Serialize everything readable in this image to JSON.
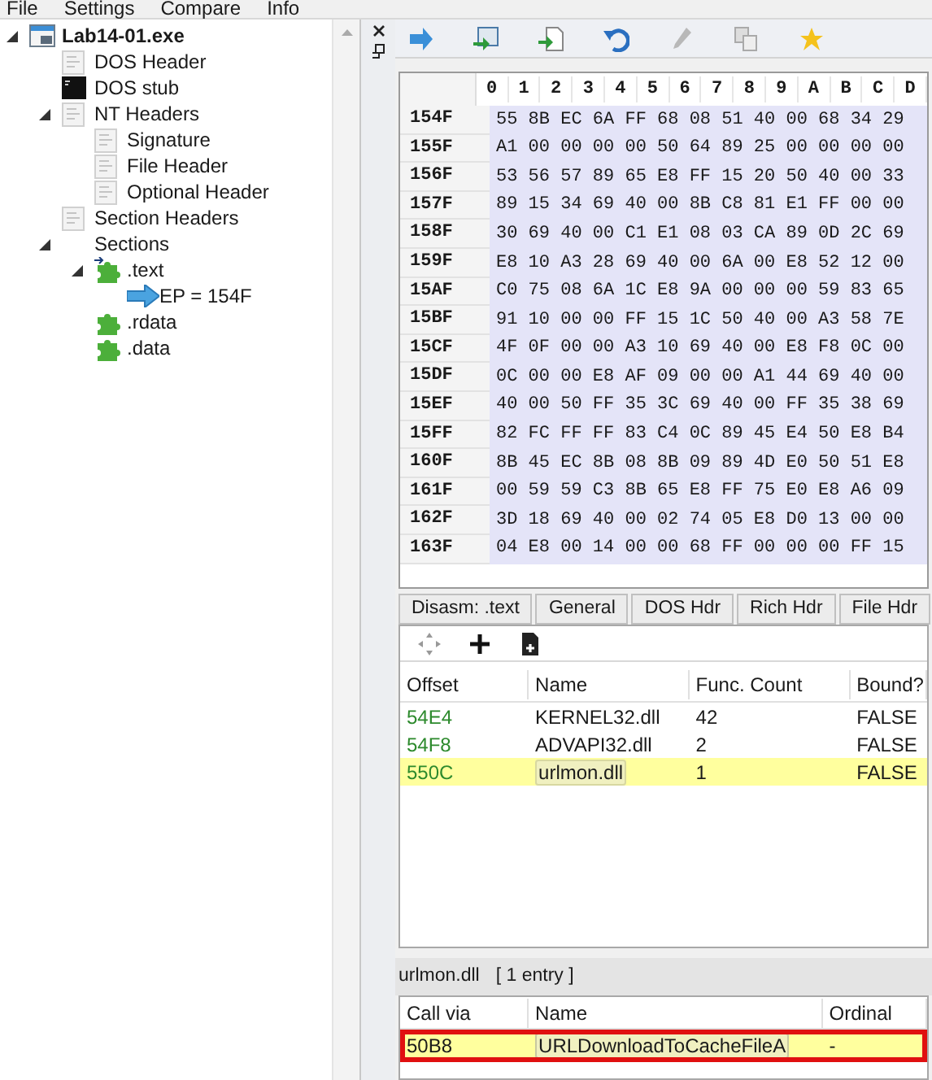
{
  "menu": [
    "File",
    "Settings",
    "Compare",
    "Info"
  ],
  "tree": [
    {
      "label": "Lab14-01.exe",
      "kind": "exe",
      "expanded": true,
      "children": [
        {
          "label": "DOS Header",
          "kind": "header"
        },
        {
          "label": "DOS stub",
          "kind": "console"
        },
        {
          "label": "NT Headers",
          "kind": "header",
          "expanded": true,
          "children": [
            {
              "label": "Signature",
              "kind": "header"
            },
            {
              "label": "File Header",
              "kind": "header"
            },
            {
              "label": "Optional Header",
              "kind": "header"
            }
          ]
        },
        {
          "label": "Section Headers",
          "kind": "header"
        },
        {
          "label": "Sections",
          "kind": "folder",
          "expanded": true,
          "children": [
            {
              "label": ".text",
              "kind": "entry-section",
              "expanded": true,
              "children": [
                {
                  "label": "EP = 154F",
                  "kind": "entry"
                }
              ]
            },
            {
              "label": ".rdata",
              "kind": "section"
            },
            {
              "label": ".data",
              "kind": "section"
            }
          ]
        }
      ]
    }
  ],
  "hex": {
    "columns": [
      "0",
      "1",
      "2",
      "3",
      "4",
      "5",
      "6",
      "7",
      "8",
      "9",
      "A",
      "B",
      "C",
      "D"
    ],
    "rows": [
      {
        "offset": "154F",
        "bytes": "55 8B EC 6A FF 68 08 51 40 00 68 34 29"
      },
      {
        "offset": "155F",
        "bytes": "A1 00 00 00 00 50 64 89 25 00 00 00 00"
      },
      {
        "offset": "156F",
        "bytes": "53 56 57 89 65 E8 FF 15 20 50 40 00 33"
      },
      {
        "offset": "157F",
        "bytes": "89 15 34 69 40 00 8B C8 81 E1 FF 00 00"
      },
      {
        "offset": "158F",
        "bytes": "30 69 40 00 C1 E1 08 03 CA 89 0D 2C 69"
      },
      {
        "offset": "159F",
        "bytes": "E8 10 A3 28 69 40 00 6A 00 E8 52 12 00"
      },
      {
        "offset": "15AF",
        "bytes": "C0 75 08 6A 1C E8 9A 00 00 00 59 83 65"
      },
      {
        "offset": "15BF",
        "bytes": "91 10 00 00 FF 15 1C 50 40 00 A3 58 7E"
      },
      {
        "offset": "15CF",
        "bytes": "4F 0F 00 00 A3 10 69 40 00 E8 F8 0C 00"
      },
      {
        "offset": "15DF",
        "bytes": "0C 00 00 E8 AF 09 00 00 A1 44 69 40 00"
      },
      {
        "offset": "15EF",
        "bytes": "40 00 50 FF 35 3C 69 40 00 FF 35 38 69"
      },
      {
        "offset": "15FF",
        "bytes": "82 FC FF FF 83 C4 0C 89 45 E4 50 E8 B4"
      },
      {
        "offset": "160F",
        "bytes": "8B 45 EC 8B 08 8B 09 89 4D E0 50 51 E8"
      },
      {
        "offset": "161F",
        "bytes": "00 59 59 C3 8B 65 E8 FF 75 E0 E8 A6 09"
      },
      {
        "offset": "162F",
        "bytes": "3D 18 69 40 00 02 74 05 E8 D0 13 00 00"
      },
      {
        "offset": "163F",
        "bytes": "04 E8 00 14 00 00 68 FF 00 00 00 FF 15"
      }
    ]
  },
  "tabs": [
    {
      "label": "Disasm: .text",
      "selected": false
    },
    {
      "label": "General",
      "selected": false
    },
    {
      "label": "DOS Hdr",
      "selected": false
    },
    {
      "label": "Rich Hdr",
      "selected": false
    },
    {
      "label": "File Hdr",
      "selected": false
    }
  ],
  "imports": {
    "columns": [
      "Offset",
      "Name",
      "Func. Count",
      "Bound?"
    ],
    "rows": [
      {
        "offset": "54E4",
        "name": "KERNEL32.dll",
        "count": "42",
        "bound": "FALSE",
        "selected": false
      },
      {
        "offset": "54F8",
        "name": "ADVAPI32.dll",
        "count": "2",
        "bound": "FALSE",
        "selected": false
      },
      {
        "offset": "550C",
        "name": "urlmon.dll",
        "count": "1",
        "bound": "FALSE",
        "selected": true
      }
    ]
  },
  "detail": {
    "dll": "urlmon.dll",
    "entries": "[ 1 entry ]"
  },
  "functions": {
    "columns": [
      "Call via",
      "Name",
      "Ordinal"
    ],
    "rows": [
      {
        "call_via": "50B8",
        "name": "URLDownloadToCacheFileA",
        "ordinal": "-",
        "selected": true
      }
    ]
  }
}
